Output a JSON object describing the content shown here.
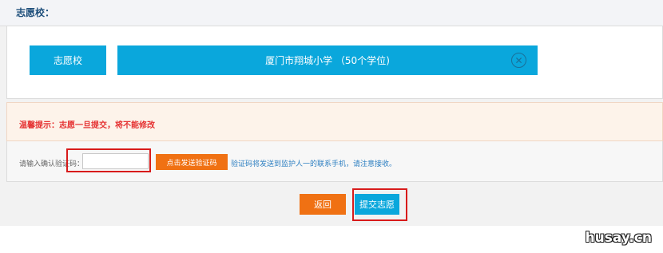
{
  "header": {
    "title": "志愿校："
  },
  "school": {
    "label": "志愿校",
    "name": "厦门市翔城小学 （50个学位)",
    "remove_icon": "close-circle-icon"
  },
  "tip": {
    "text": "温馨提示：志愿一旦提交，将不能修改"
  },
  "verification": {
    "label": "请输入确认验证码：",
    "input_value": "",
    "input_placeholder": "",
    "send_button": "点击发送验证码",
    "note": "验证码将发送到监护人一的联系手机，请注意接收。"
  },
  "actions": {
    "back": "返回",
    "submit": "提交志愿"
  },
  "watermark": "husay.cn",
  "colors": {
    "accent_blue": "#0aa7dc",
    "accent_orange": "#f07113",
    "warning_red": "#e53232",
    "highlight_red": "#d81b1b"
  }
}
